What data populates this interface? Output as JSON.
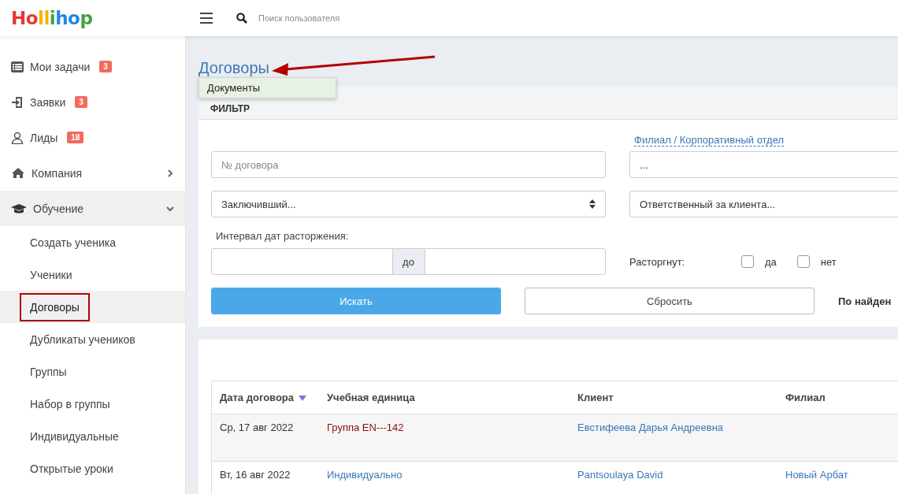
{
  "logo": "Hollihop",
  "search": {
    "placeholder": "Поиск пользователя"
  },
  "sidebar": {
    "items": [
      {
        "label": "Мои задачи",
        "badge": "3"
      },
      {
        "label": "Заявки",
        "badge": "3"
      },
      {
        "label": "Лиды",
        "badge": "18"
      },
      {
        "label": "Компания",
        "expanded": false
      },
      {
        "label": "Обучение",
        "expanded": true,
        "children": [
          {
            "label": "Создать ученика",
            "selected": false
          },
          {
            "label": "Ученики",
            "selected": false
          },
          {
            "label": "Договоры",
            "selected": true
          },
          {
            "label": "Дубликаты учеников",
            "selected": false
          },
          {
            "label": "Группы",
            "selected": false
          },
          {
            "label": "Набор в группы",
            "selected": false
          },
          {
            "label": "Индивидуальные",
            "selected": false
          },
          {
            "label": "Открытые уроки",
            "selected": false
          }
        ]
      }
    ]
  },
  "page_title": "Договоры",
  "tooltip": "Документы",
  "filter": {
    "title": "ФИЛЬТР",
    "branch_link": "Филиал / Корпоративный отдел",
    "contract_number": {
      "placeholder": "№ договора"
    },
    "branch": {
      "value": "..."
    },
    "signed_by": {
      "value": "Заключивший..."
    },
    "responsible": {
      "value": "Ответственный за клиента..."
    },
    "interval_label": "Интервал дат расторжения:",
    "interval_separator": "до",
    "terminated_label": "Расторгнут:",
    "options": [
      {
        "label": "да",
        "checked": false
      },
      {
        "label": "нет",
        "checked": false
      }
    ],
    "search_button": "Искать",
    "reset_button": "Сбросить",
    "found_label": "По найден"
  },
  "table": {
    "columns": [
      "Дата договора",
      "Учебная единица",
      "Клиент",
      "Филиал"
    ],
    "rows": [
      {
        "date": "Ср, 17 авг 2022",
        "unit": "Группа EN---142",
        "color": "#8b0f0f",
        "client": "Евстифеева Дарья Андреевна"
      },
      {
        "date": "Вт, 16 авг 2022",
        "unit": "Индивидуально",
        "color": "#3a78b5",
        "client": "Pantsoulaya David",
        "branch": "Новый Арбат"
      }
    ]
  }
}
